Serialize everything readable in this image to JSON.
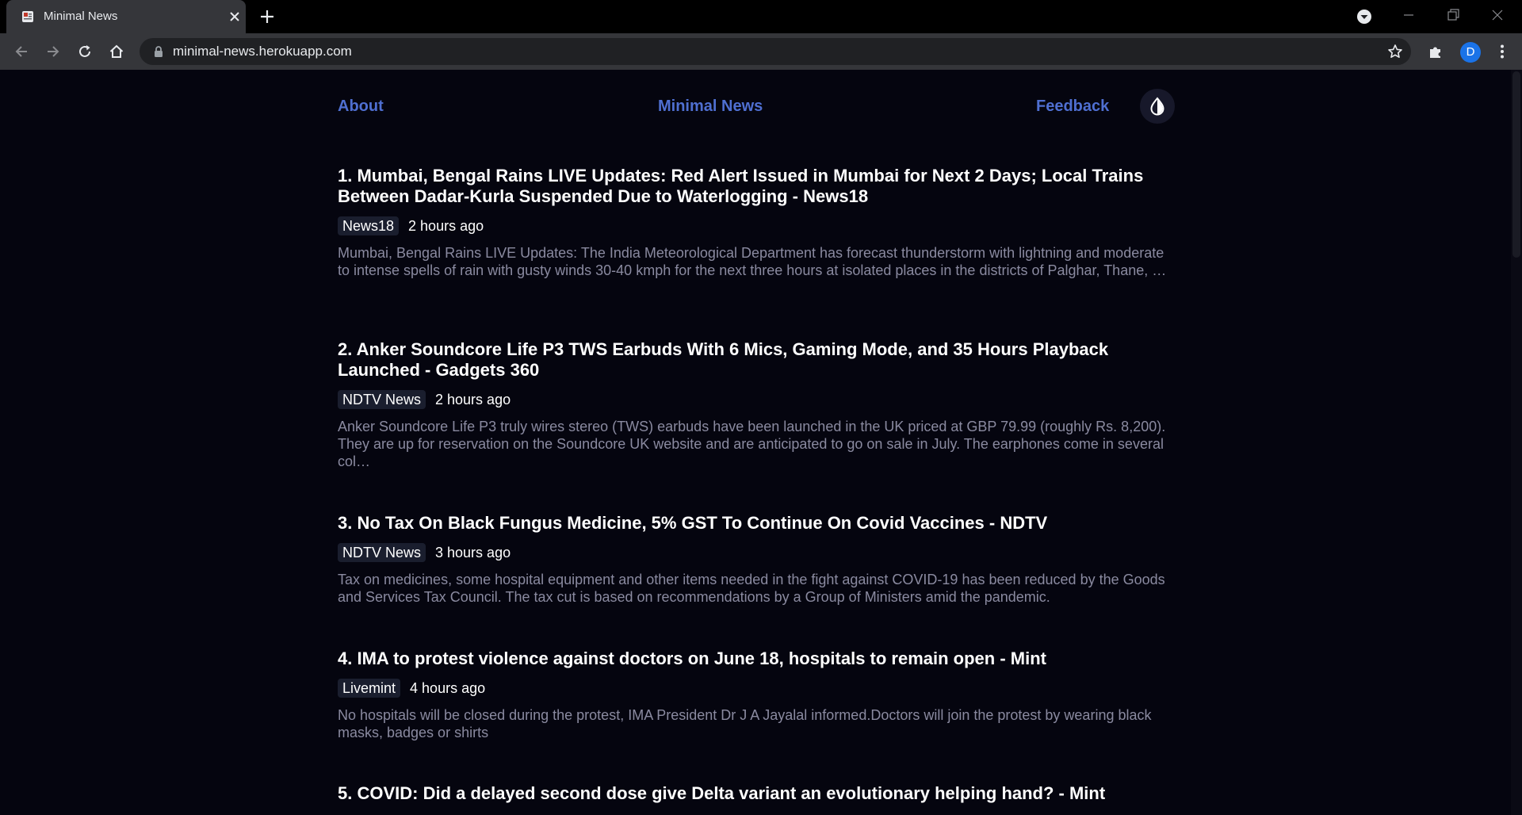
{
  "browser": {
    "tab_title": "Minimal News",
    "url": "minimal-news.herokuapp.com",
    "profile_initial": "D"
  },
  "nav": {
    "about": "About",
    "home": "Minimal News",
    "feedback": "Feedback"
  },
  "articles": [
    {
      "title": "1. Mumbai, Bengal Rains LIVE Updates: Red Alert Issued in Mumbai for Next 2 Days; Local Trains Between Dadar-Kurla Suspended Due to Waterlogging - News18",
      "source": "News18",
      "time": "2 hours ago",
      "description": "Mumbai, Bengal Rains LIVE Updates: The India Meteorological Department has forecast thunderstorm with lightning and moderate to intense spells of rain with gusty winds 30-40 kmph for the next three hours at isolated places in the districts of Palghar, Thane, …"
    },
    {
      "title": "2. Anker Soundcore Life P3 TWS Earbuds With 6 Mics, Gaming Mode, and 35 Hours Playback Launched - Gadgets 360",
      "source": "NDTV News",
      "time": "2 hours ago",
      "description": "Anker Soundcore Life P3 truly wires stereo (TWS) earbuds have been launched in the UK priced at GBP 79.99 (roughly Rs. 8,200). They are up for reservation on the Soundcore UK website and are anticipated to go on sale in July. The earphones come in several col…"
    },
    {
      "title": "3. No Tax On Black Fungus Medicine, 5% GST To Continue On Covid Vaccines - NDTV",
      "source": "NDTV News",
      "time": "3 hours ago",
      "description": "Tax on medicines, some hospital equipment and other items needed in the fight against COVID-19 has been reduced by the Goods and Services Tax Council. The tax cut is based on recommendations by a Group of Ministers amid the pandemic."
    },
    {
      "title": "4. IMA to protest violence against doctors on June 18, hospitals to remain open - Mint",
      "source": "Livemint",
      "time": "4 hours ago",
      "description": "No hospitals will be closed during the protest, IMA President Dr J A Jayalal informed.Doctors will join the protest by wearing black masks, badges or shirts"
    },
    {
      "title": "5. COVID: Did a delayed second dose give Delta variant an evolutionary helping hand? - Mint",
      "source": "",
      "time": "",
      "description": ""
    }
  ]
}
